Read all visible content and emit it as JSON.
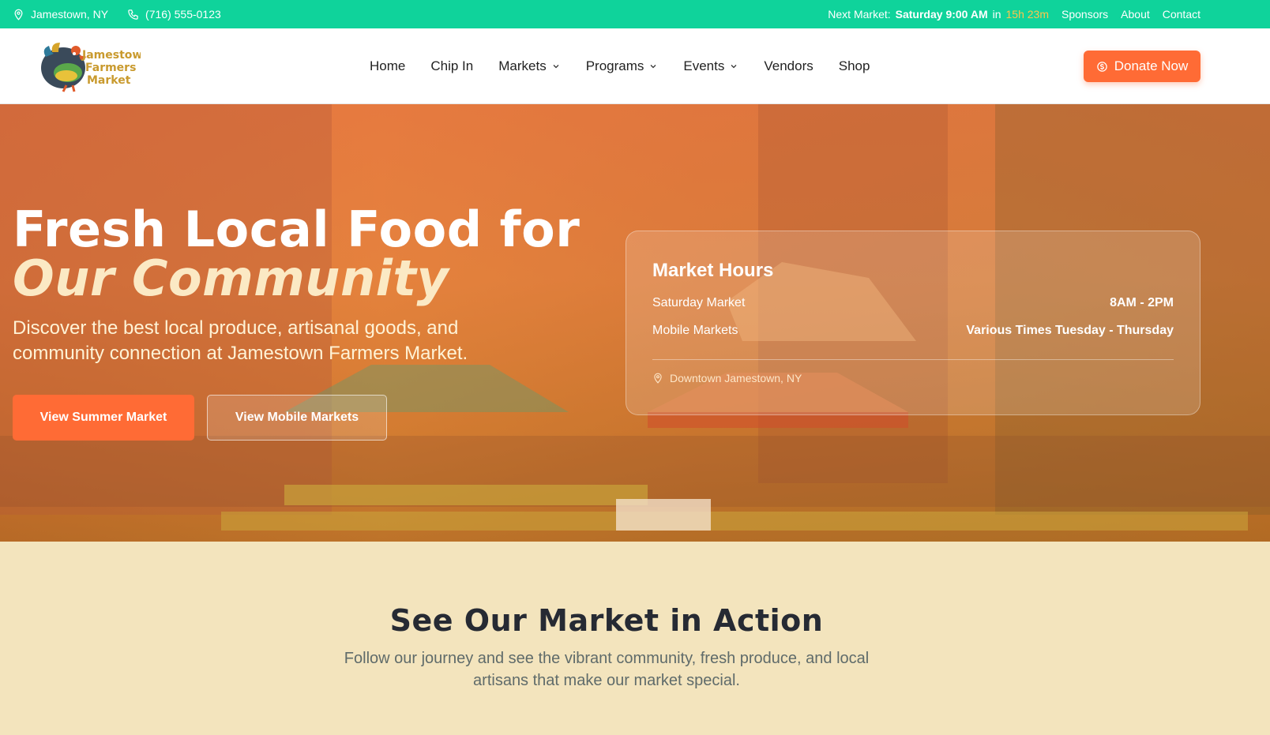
{
  "topbar": {
    "location": "Jamestown, NY",
    "phone": "(716) 555-0123",
    "next_label": "Next Market:",
    "next_day": "Saturday 9:00 AM",
    "in_label": "in",
    "countdown": "15h 23m",
    "links": [
      "Sponsors",
      "About",
      "Contact"
    ],
    "bg_color": "#0fd39b",
    "countdown_color": "#ffc54a"
  },
  "header": {
    "logo_text": [
      "Jamestown",
      "Farmers",
      "Market"
    ],
    "nav": [
      {
        "label": "Home",
        "dropdown": false
      },
      {
        "label": "Chip In",
        "dropdown": false
      },
      {
        "label": "Markets",
        "dropdown": true
      },
      {
        "label": "Programs",
        "dropdown": true
      },
      {
        "label": "Events",
        "dropdown": true
      },
      {
        "label": "Vendors",
        "dropdown": false
      },
      {
        "label": "Shop",
        "dropdown": false
      }
    ],
    "donate_label": "Donate Now",
    "donate_icon": "dollar-circle-icon",
    "accent_color": "#ff6b35"
  },
  "hero": {
    "title_line1": "Fresh Local Food for",
    "title_line2": "Our Community",
    "subtitle": "Discover the best local produce, artisanal goods, and community connection at Jamestown Farmers Market.",
    "primary_button": "View Summer Market",
    "secondary_button": "View Mobile Markets",
    "hours_card": {
      "title": "Market Hours",
      "rows": [
        {
          "label": "Saturday Market",
          "value": "8AM - 2PM"
        },
        {
          "label": "Mobile Markets",
          "value": "Various Times Tuesday - Thursday"
        }
      ],
      "location": "Downtown Jamestown, NY"
    }
  },
  "section": {
    "title": "See Our Market in Action",
    "subtitle": "Follow our journey and see the vibrant community, fresh produce, and local artisans that make our market special."
  }
}
